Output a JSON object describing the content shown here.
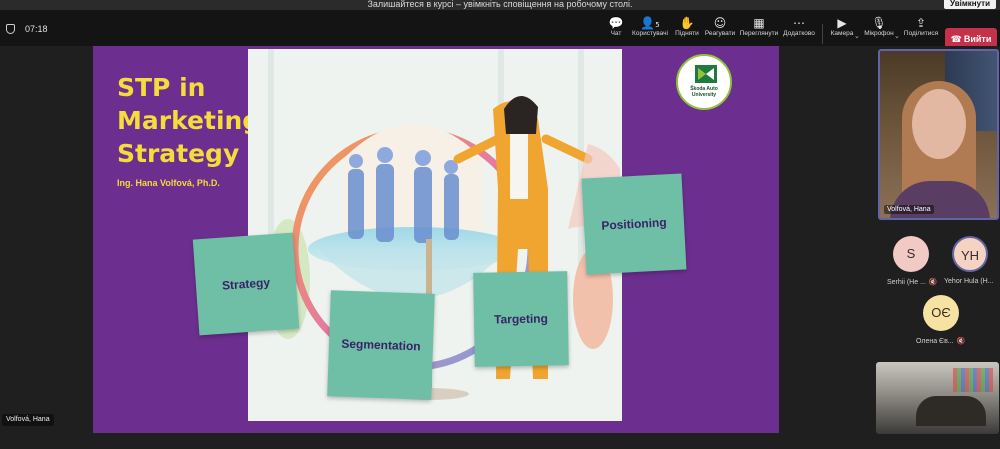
{
  "notification": {
    "message": "Залишайтеся в курсі – увімкніть сповіщення на робочому столі.",
    "button": "Увімкнути"
  },
  "toolbar": {
    "timer": "07:18",
    "items": [
      {
        "label": "Чат",
        "icon": "chat-icon"
      },
      {
        "label": "Користувачі",
        "icon": "people-icon",
        "count": "5"
      },
      {
        "label": "Підняти",
        "icon": "raise-hand-icon"
      },
      {
        "label": "Реагувати",
        "icon": "react-icon"
      },
      {
        "label": "Переглянути",
        "icon": "view-icon"
      },
      {
        "label": "Додатково",
        "icon": "more-icon"
      },
      {
        "label": "Камера",
        "icon": "camera-icon"
      },
      {
        "label": "Мікрофон",
        "icon": "mic-off-icon"
      },
      {
        "label": "Поділитися",
        "icon": "share-icon"
      }
    ],
    "leave_label": "Вийти",
    "leave_color": "#c4314b"
  },
  "slide": {
    "title": "STP in Marketing Strategy",
    "author": "Ing. Hana Volfová, Ph.D.",
    "cards": [
      "Strategy",
      "Segmentation",
      "Targeting",
      "Positioning"
    ],
    "logo_text": "Škoda Auto University",
    "background_color": "#6c2f8f",
    "title_color": "#f4dc3b",
    "card_color": "#6fbfa7"
  },
  "presenter_tag": "Volfová, Hana",
  "participants": {
    "main_video_label": "Volfová, Hana",
    "avatars": [
      {
        "initials": "S",
        "label": "Serhii (Не ...",
        "color": "#f1c9c5"
      },
      {
        "initials": "YH",
        "label": "Yehor Hula (H...",
        "color": "#f5d2c2"
      },
      {
        "initials": "ОЄ",
        "label": "Олена Єв...",
        "color": "#f7e3a1"
      }
    ]
  }
}
